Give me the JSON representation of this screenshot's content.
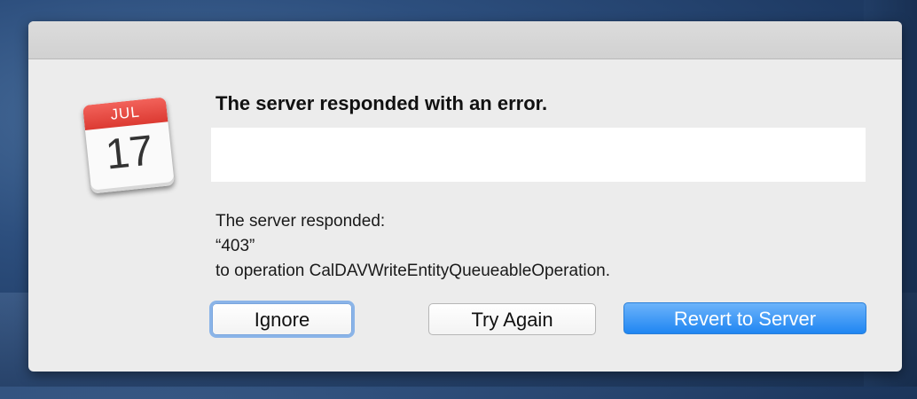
{
  "dialog": {
    "calendar_icon": {
      "month": "JUL",
      "day": "17"
    },
    "heading": "The server responded with an error.",
    "message_lines": [
      "The server responded:",
      "“403”",
      "to operation CalDAVWriteEntityQueueableOperation."
    ],
    "buttons": {
      "ignore": "Ignore",
      "try_again": "Try Again",
      "revert": "Revert to Server"
    }
  },
  "colors": {
    "primary_button": "#1f86f2",
    "calendar_red": "#dc3a32",
    "focus_ring": "#8ab4e8"
  }
}
